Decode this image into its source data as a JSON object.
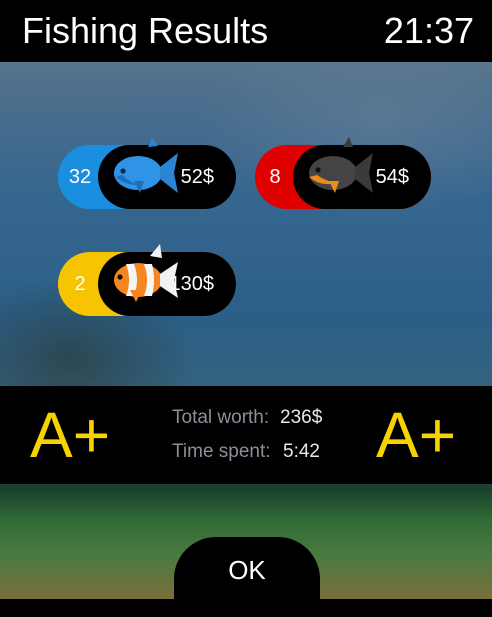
{
  "header": {
    "title": "Fishing Results",
    "time": "21:37"
  },
  "catches": [
    {
      "count": "32",
      "price": "52$",
      "color": "#1a8fe0",
      "icon": "blue-fish-icon"
    },
    {
      "count": "8",
      "price": "54$",
      "color": "#e00000",
      "icon": "black-fish-icon"
    },
    {
      "count": "2",
      "price": "130$",
      "color": "#f6c400",
      "icon": "clownfish-icon"
    }
  ],
  "summary": {
    "grade_left": "A+",
    "grade_right": "A+",
    "total_worth_label": "Total worth:",
    "total_worth_value": "236$",
    "time_spent_label": "Time spent:",
    "time_spent_value": "5:42"
  },
  "actions": {
    "ok_label": "OK"
  },
  "colors": {
    "grade": "#f6d300",
    "bar": "#000000"
  }
}
